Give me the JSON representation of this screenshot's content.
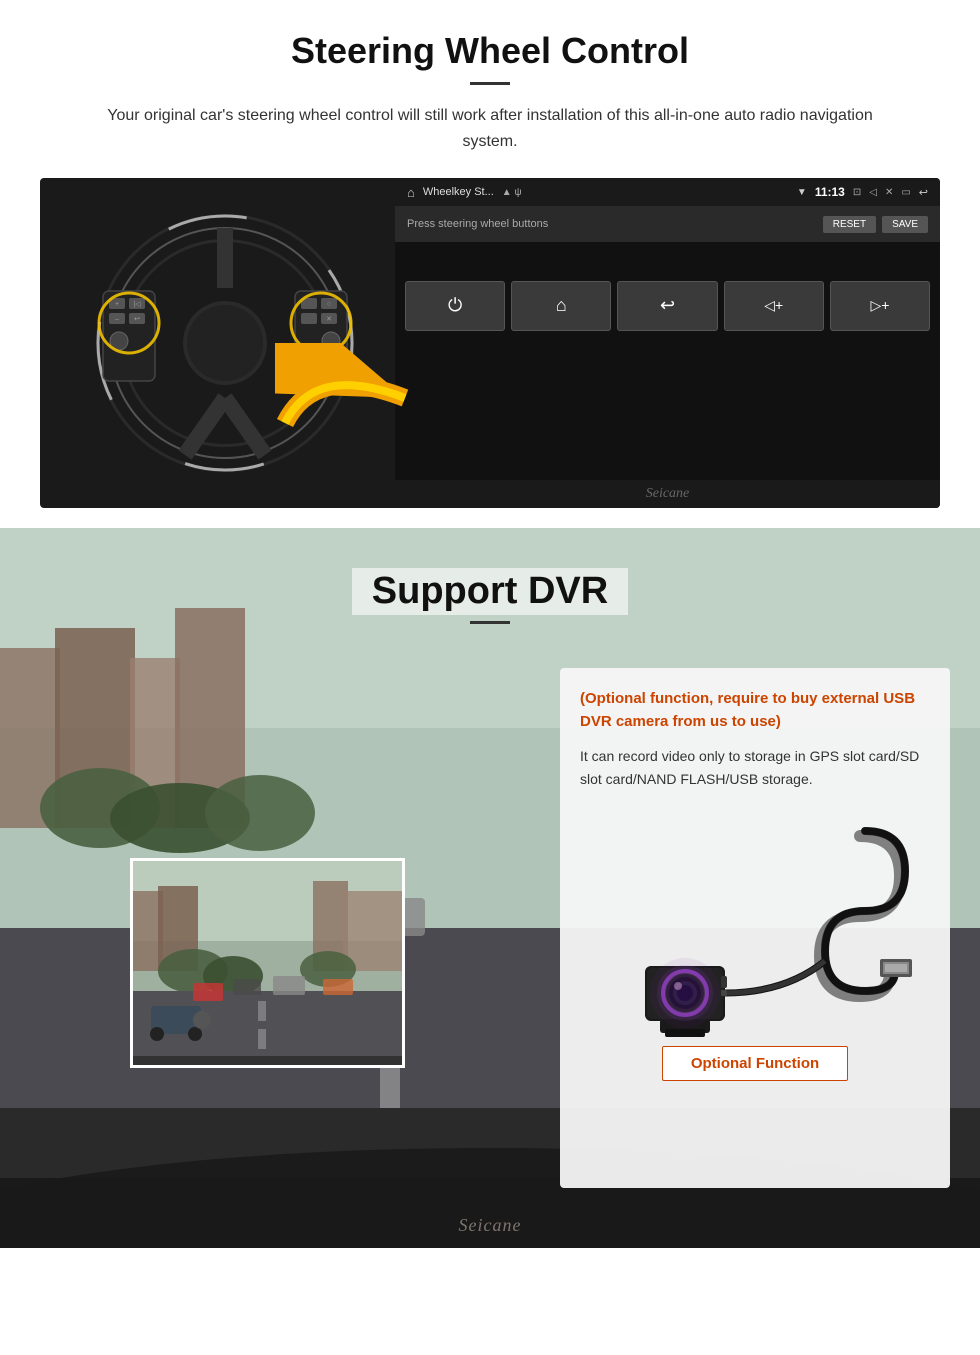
{
  "steering": {
    "title": "Steering Wheel Control",
    "description": "Your original car's steering wheel control will still work after installation of this all-in-one auto radio navigation system.",
    "statusbar": {
      "home_icon": "⌂",
      "nav_title": "Wheelkey St...",
      "icons": "▲ ψ",
      "wifi": "▼",
      "time": "11:13",
      "camera_icon": "□",
      "volume_icon": "◁",
      "x_icon": "✕",
      "back_icon": "⟵",
      "back2_icon": "↩"
    },
    "control_bar": {
      "press_text": "Press steering wheel buttons",
      "reset_btn": "RESET",
      "save_btn": "SAVE"
    },
    "function_buttons": [
      {
        "icon": "⏻",
        "label": "power"
      },
      {
        "icon": "⌂",
        "label": "home"
      },
      {
        "icon": "↩",
        "label": "back"
      },
      {
        "icon": "◁+",
        "label": "vol-down"
      },
      {
        "icon": "▷+",
        "label": "vol-up"
      }
    ],
    "watermark": "Seicane"
  },
  "dvr": {
    "title": "Support DVR",
    "optional_text": "(Optional function, require to buy external USB DVR camera from us to use)",
    "description": "It can record video only to storage in GPS slot card/SD slot card/NAND FLASH/USB storage.",
    "optional_function_label": "Optional Function",
    "watermark": "Seicane"
  }
}
